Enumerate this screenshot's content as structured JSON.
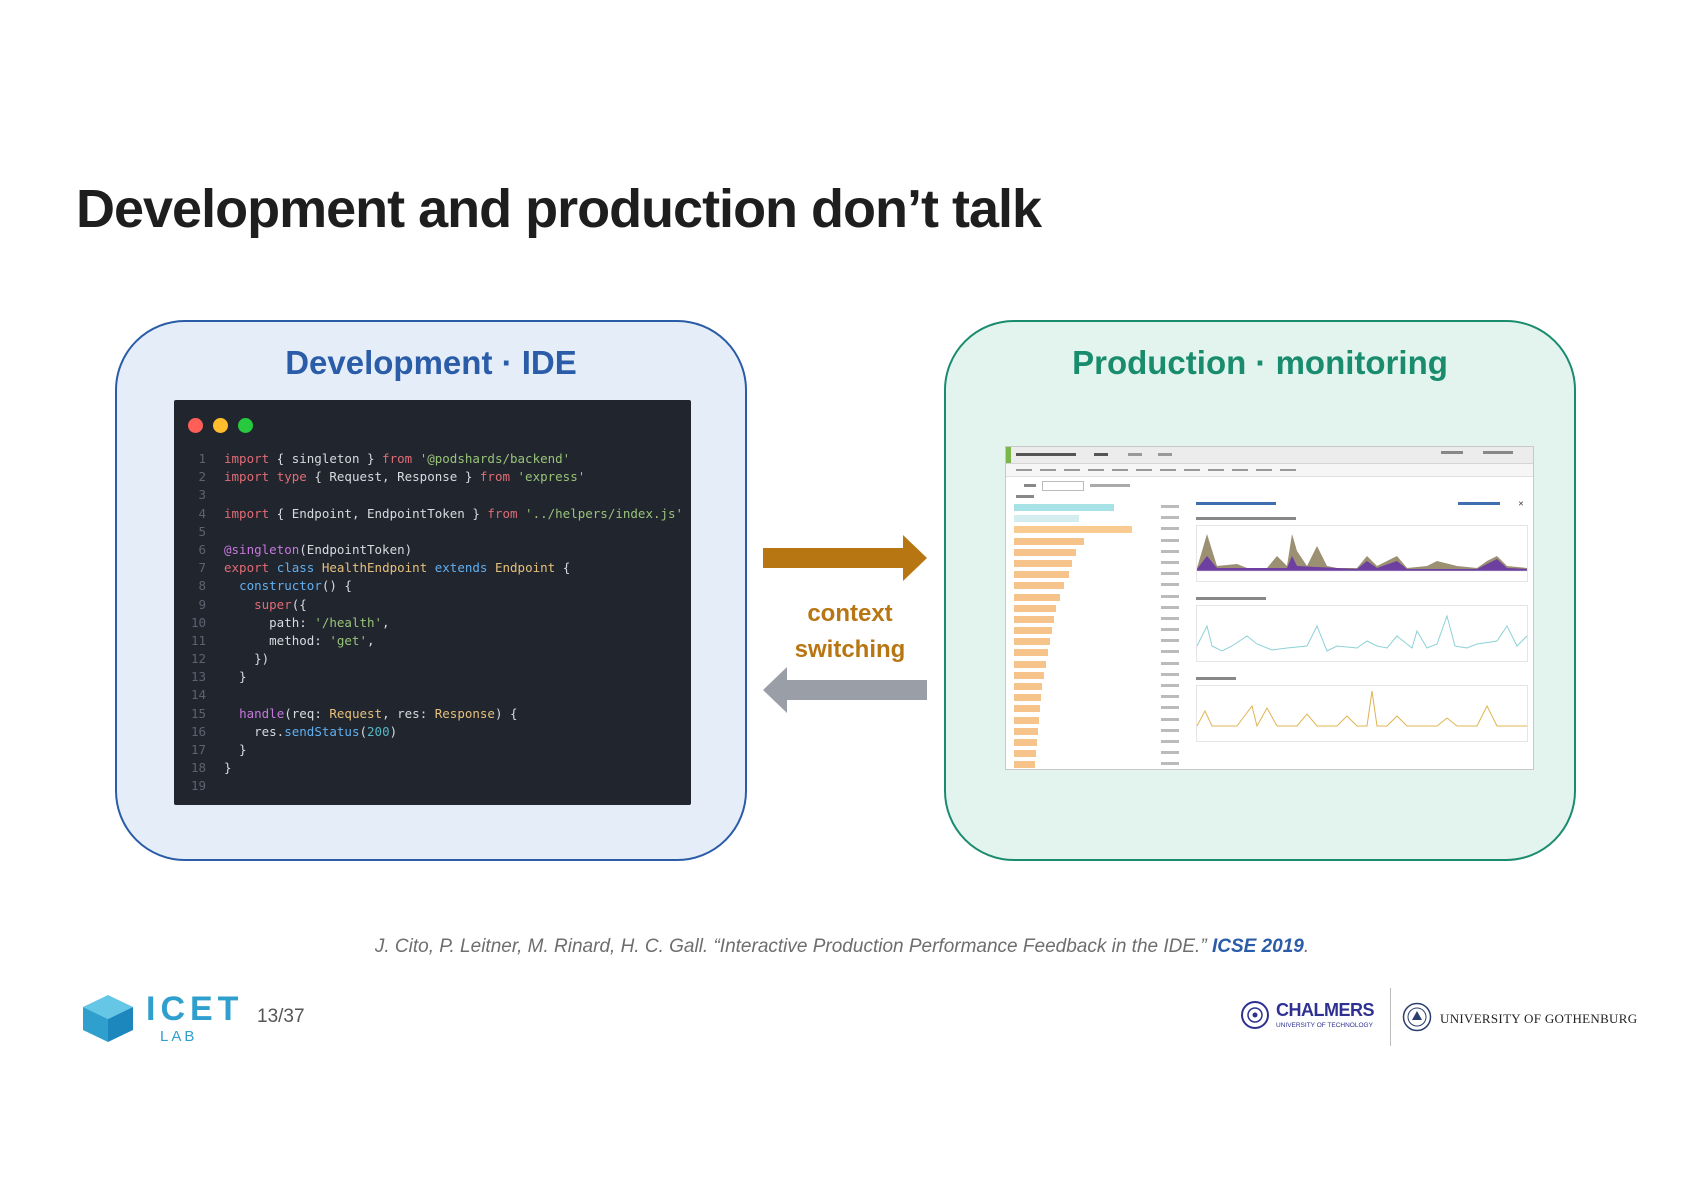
{
  "slide": {
    "title": "Development and production don’t talk",
    "page": "13/37"
  },
  "dev_panel": {
    "title": "Development  ·  IDE",
    "code_lines": [
      "1",
      "2",
      "3",
      "4",
      "5",
      "6",
      "7",
      "8",
      "9",
      "10",
      "11",
      "12",
      "13",
      "14",
      "15",
      "16",
      "17",
      "18",
      "19"
    ]
  },
  "prod_panel": {
    "title": "Production  ·  monitoring"
  },
  "middle": {
    "label_line1": "context",
    "label_line2": "switching"
  },
  "citation": {
    "text": "J. Cito, P. Leitner, M. Rinard, H. C. Gall. “Interactive Production Performance Feedback in the IDE.” ",
    "venue": "ICSE 2019",
    "end": "."
  },
  "footer": {
    "lab_logo_text": "ICET",
    "lab_logo_sub": "LAB",
    "chalmers_name": "CHALMERS",
    "chalmers_sub": "UNIVERSITY OF TECHNOLOGY",
    "gu_name": "UNIVERSITY OF GOTHENBURG"
  },
  "colors": {
    "dev_accent": "#2a5ca8",
    "prod_accent": "#1a8c6e",
    "arrow_forward": "#b87613",
    "arrow_back": "#9a9ea6",
    "window_red": "#ff5f56",
    "window_yellow": "#ffbd2e",
    "window_green": "#27c93f"
  }
}
